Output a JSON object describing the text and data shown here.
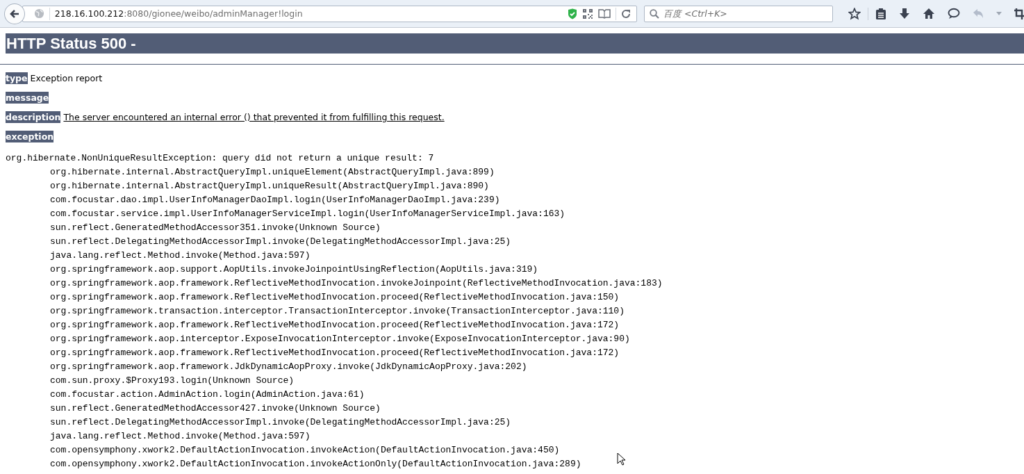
{
  "toolbar": {
    "url_host": "218.16.100.212",
    "url_path": ":8080/gionee/weibo/adminManager!login",
    "search": {
      "placeholder": "百度 <Ctrl+K>"
    }
  },
  "heading": "HTTP Status 500 -",
  "fields": [
    {
      "label": "type",
      "value": "Exception report",
      "kind": "plain"
    },
    {
      "label": "message"
    },
    {
      "label": "description",
      "value": "The server encountered an internal error () that prevented it from fulfilling this request.",
      "kind": "underlined"
    },
    {
      "label": "exception"
    }
  ],
  "exception": {
    "head": "org.hibernate.NonUniqueResultException: query did not return a unique result: 7",
    "frames": [
      "org.hibernate.internal.AbstractQueryImpl.uniqueElement(AbstractQueryImpl.java:899)",
      "org.hibernate.internal.AbstractQueryImpl.uniqueResult(AbstractQueryImpl.java:890)",
      "com.focustar.dao.impl.UserInfoManagerDaoImpl.login(UserInfoManagerDaoImpl.java:239)",
      "com.focustar.service.impl.UserInfoManagerServiceImpl.login(UserInfoManagerServiceImpl.java:163)",
      "sun.reflect.GeneratedMethodAccessor351.invoke(Unknown Source)",
      "sun.reflect.DelegatingMethodAccessorImpl.invoke(DelegatingMethodAccessorImpl.java:25)",
      "java.lang.reflect.Method.invoke(Method.java:597)",
      "org.springframework.aop.support.AopUtils.invokeJoinpointUsingReflection(AopUtils.java:319)",
      "org.springframework.aop.framework.ReflectiveMethodInvocation.invokeJoinpoint(ReflectiveMethodInvocation.java:183)",
      "org.springframework.aop.framework.ReflectiveMethodInvocation.proceed(ReflectiveMethodInvocation.java:150)",
      "org.springframework.transaction.interceptor.TransactionInterceptor.invoke(TransactionInterceptor.java:110)",
      "org.springframework.aop.framework.ReflectiveMethodInvocation.proceed(ReflectiveMethodInvocation.java:172)",
      "org.springframework.aop.interceptor.ExposeInvocationInterceptor.invoke(ExposeInvocationInterceptor.java:90)",
      "org.springframework.aop.framework.ReflectiveMethodInvocation.proceed(ReflectiveMethodInvocation.java:172)",
      "org.springframework.aop.framework.JdkDynamicAopProxy.invoke(JdkDynamicAopProxy.java:202)",
      "com.sun.proxy.$Proxy193.login(Unknown Source)",
      "com.focustar.action.AdminAction.login(AdminAction.java:61)",
      "sun.reflect.GeneratedMethodAccessor427.invoke(Unknown Source)",
      "sun.reflect.DelegatingMethodAccessorImpl.invoke(DelegatingMethodAccessorImpl.java:25)",
      "java.lang.reflect.Method.invoke(Method.java:597)",
      "com.opensymphony.xwork2.DefaultActionInvocation.invokeAction(DefaultActionInvocation.java:450)",
      "com.opensymphony.xwork2.DefaultActionInvocation.invokeActionOnly(DefaultActionInvocation.java:289)"
    ]
  }
}
